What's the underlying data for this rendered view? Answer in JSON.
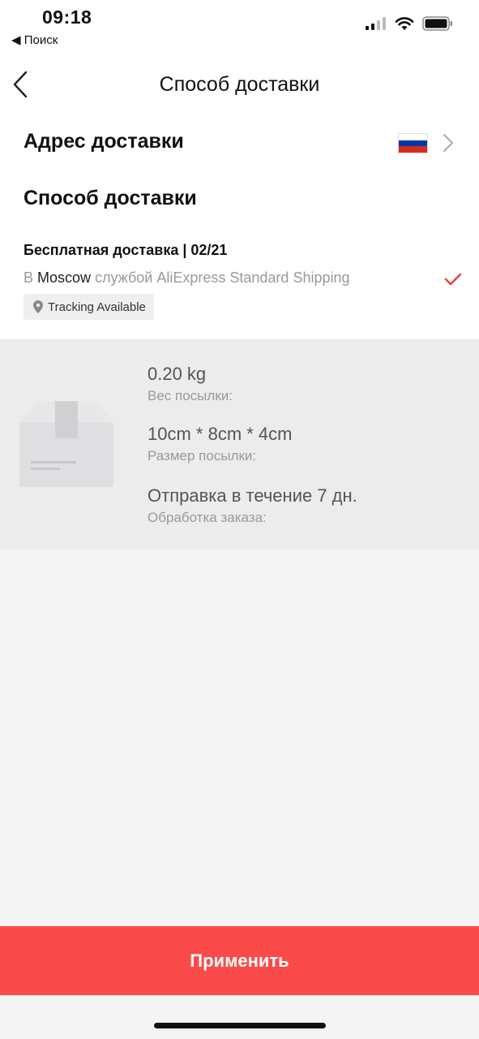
{
  "status_bar": {
    "time": "09:18",
    "back_app": "◀ Поиск",
    "icons": [
      "cellular-signal-icon",
      "wifi-icon",
      "battery-icon"
    ]
  },
  "nav": {
    "title": "Способ доставки",
    "back_icon": "chevron-left-icon"
  },
  "address": {
    "title": "Адрес доставки",
    "flag_icon": "russia-flag-icon",
    "flag_colors": [
      "#ffffff",
      "#0039a6",
      "#d52b1e"
    ]
  },
  "shipping": {
    "title": "Способ доставки",
    "option": {
      "title": "Бесплатная доставка | 02/21",
      "desc_prefix": "В ",
      "city": "Moscow",
      "desc_suffix": " службой AliExpress Standard Shipping",
      "selected": true,
      "tracking": "Tracking Available"
    }
  },
  "package": {
    "weight_value": "0.20 kg",
    "weight_label": "Вес посылки:",
    "size_value": "10cm * 8cm * 4cm",
    "size_label": "Размер посылки:",
    "processing_value": "Отправка в течение 7 дн.",
    "processing_label": "Обработка заказа:"
  },
  "apply_button": "Применить",
  "colors": {
    "accent": "#fb4a4a",
    "check": "#e8453c"
  }
}
